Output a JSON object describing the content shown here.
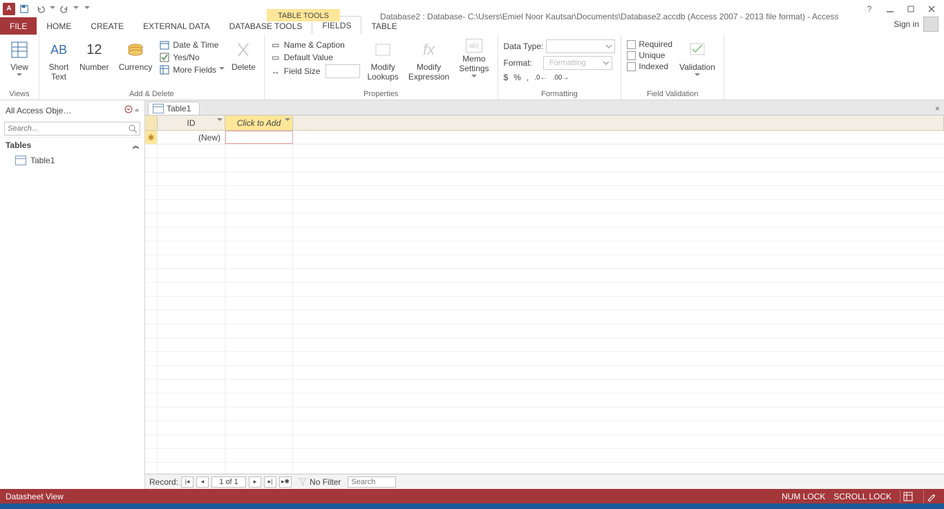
{
  "titlebar": {
    "table_tools": "TABLE TOOLS",
    "title": "Database2 : Database- C:\\Users\\Emiel Noor Kautsar\\Documents\\Database2.accdb (Access 2007 - 2013 file format) - Access"
  },
  "tabs": {
    "file": "FILE",
    "home": "HOME",
    "create": "CREATE",
    "external": "EXTERNAL DATA",
    "dbtools": "DATABASE TOOLS",
    "fields": "FIELDS",
    "table": "TABLE",
    "signin": "Sign in"
  },
  "ribbon": {
    "views": {
      "view": "View",
      "group": "Views"
    },
    "addDelete": {
      "short_text": "Short\nText",
      "number": "Number",
      "currency": "Currency",
      "date_time": "Date & Time",
      "yes_no": "Yes/No",
      "more_fields": "More Fields",
      "delete": "Delete",
      "group": "Add & Delete",
      "ab": "AB",
      "twelve": "12"
    },
    "properties": {
      "name_caption": "Name & Caption",
      "default_value": "Default Value",
      "field_size": "Field Size",
      "modify_lookups": "Modify\nLookups",
      "modify_expression": "Modify\nExpression",
      "memo_settings": "Memo\nSettings",
      "group": "Properties"
    },
    "formatting": {
      "data_type": "Data Type:",
      "format": "Format:",
      "formatting_ph": "Formatting",
      "group": "Formatting"
    },
    "validation": {
      "required": "Required",
      "unique": "Unique",
      "indexed": "Indexed",
      "validation": "Validation",
      "group": "Field Validation"
    }
  },
  "nav": {
    "title": "All Access Obje…",
    "search_ph": "Search...",
    "tables": "Tables",
    "table1": "Table1"
  },
  "doc": {
    "tab": "Table1"
  },
  "datasheet": {
    "id": "ID",
    "click_to_add": "Click to Add",
    "new": "(New)"
  },
  "recordnav": {
    "label": "Record:",
    "pos": "1 of 1",
    "no_filter": "No Filter",
    "search": "Search"
  },
  "status": {
    "view": "Datasheet View",
    "numlock": "NUM LOCK",
    "scrolllock": "SCROLL LOCK"
  }
}
